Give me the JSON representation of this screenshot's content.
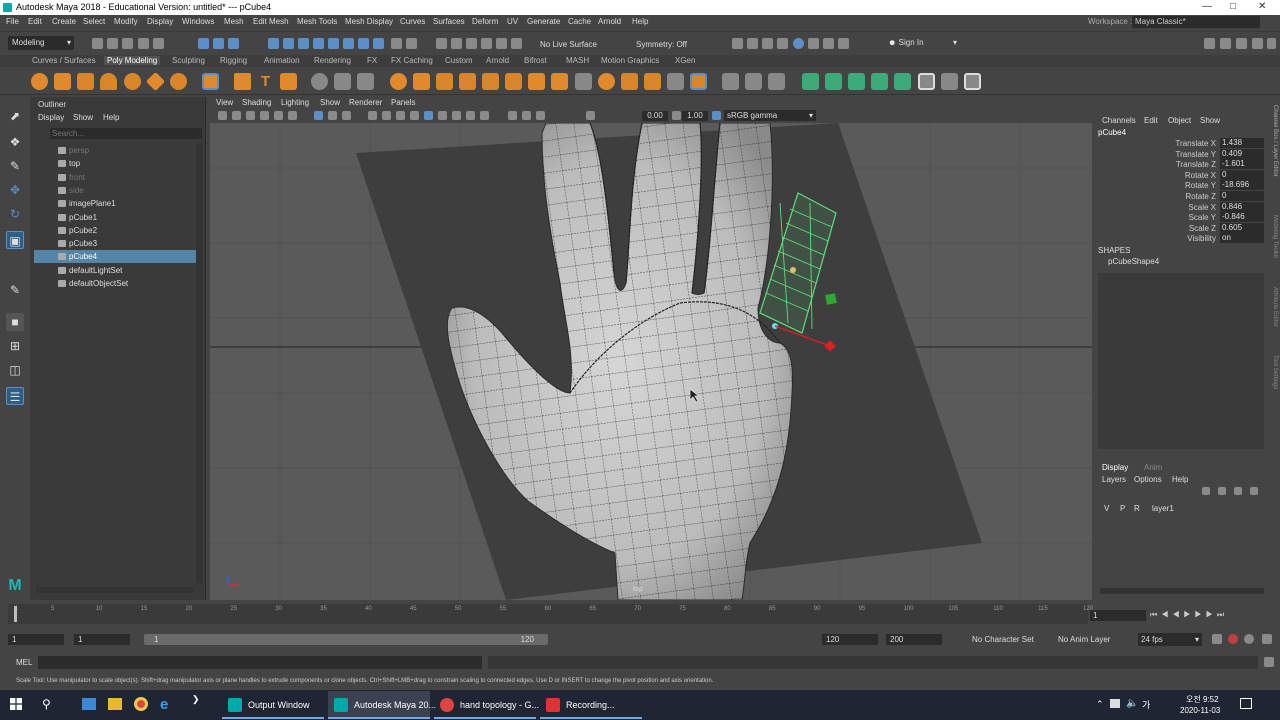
{
  "window": {
    "title": "Autodesk Maya 2018 - Educational Version: untitled*   ---   pCube4"
  },
  "menubar": {
    "items": [
      "File",
      "Edit",
      "Create",
      "Select",
      "Modify",
      "Display",
      "Windows",
      "Mesh",
      "Edit Mesh",
      "Mesh Tools",
      "Mesh Display",
      "Curves",
      "Surfaces",
      "Deform",
      "UV",
      "Generate",
      "Cache",
      "Arnold",
      "Help"
    ],
    "workspace_label": "Workspace :",
    "workspace_value": "Maya Classic*"
  },
  "statusline": {
    "mode": "Modeling",
    "live_surface": "No Live Surface",
    "symmetry": "Symmetry: Off",
    "sign_in": "Sign In"
  },
  "shelf": {
    "tabs": [
      "Curves / Surfaces",
      "Poly Modeling",
      "Sculpting",
      "Rigging",
      "Animation",
      "Rendering",
      "FX",
      "FX Caching",
      "Custom",
      "Arnold",
      "Bifrost",
      "MASH",
      "Motion Graphics",
      "XGen"
    ],
    "active": "Poly Modeling"
  },
  "outliner": {
    "title": "Outliner",
    "menu": [
      "Display",
      "Show",
      "Help"
    ],
    "search_placeholder": "Search...",
    "items": [
      {
        "label": "persp",
        "dim": true
      },
      {
        "label": "top",
        "dim": false
      },
      {
        "label": "front",
        "dim": true
      },
      {
        "label": "side",
        "dim": true
      },
      {
        "label": "imagePlane1",
        "dim": false
      },
      {
        "label": "pCube1",
        "dim": false
      },
      {
        "label": "pCube2",
        "dim": false
      },
      {
        "label": "pCube3",
        "dim": false
      },
      {
        "label": "pCube4",
        "dim": false,
        "selected": true
      },
      {
        "label": "defaultLightSet",
        "dim": false
      },
      {
        "label": "defaultObjectSet",
        "dim": false
      }
    ]
  },
  "viewport": {
    "menu": [
      "View",
      "Shading",
      "Lighting",
      "Show",
      "Renderer",
      "Panels"
    ],
    "field1": "0.00",
    "field2": "1.00",
    "colorspace": "sRGB gamma",
    "camera_label": "top"
  },
  "channelbox": {
    "menu": [
      "Channels",
      "Edit",
      "Object",
      "Show"
    ],
    "object": "pCube4",
    "channels": [
      {
        "label": "Translate X",
        "value": "1.438"
      },
      {
        "label": "Translate Y",
        "value": "0.409"
      },
      {
        "label": "Translate Z",
        "value": "-1.601"
      },
      {
        "label": "Rotate X",
        "value": "0"
      },
      {
        "label": "Rotate Y",
        "value": "-18.696"
      },
      {
        "label": "Rotate Z",
        "value": "0"
      },
      {
        "label": "Scale X",
        "value": "0.846"
      },
      {
        "label": "Scale Y",
        "value": "-0.846"
      },
      {
        "label": "Scale Z",
        "value": "0.605"
      },
      {
        "label": "Visibility",
        "value": "on"
      }
    ],
    "shapes_header": "SHAPES",
    "shape": "pCubeShape4",
    "side_tabs": [
      "Channel Box / Layer Editor",
      "Modeling Toolkit",
      "Attribute Editor",
      "Tool Settings"
    ]
  },
  "layers": {
    "tabs": [
      "Display",
      "Anim"
    ],
    "menu": [
      "Layers",
      "Options",
      "Help"
    ],
    "row": {
      "v": "V",
      "p": "P",
      "r": "R",
      "name": "layer1"
    }
  },
  "timeline": {
    "ticks": [
      "1",
      "5",
      "10",
      "15",
      "20",
      "25",
      "30",
      "35",
      "40",
      "45",
      "50",
      "55",
      "60",
      "65",
      "70",
      "75",
      "80",
      "85",
      "90",
      "95",
      "100",
      "105",
      "110",
      "115",
      "120"
    ],
    "current": "1"
  },
  "range": {
    "start": "1",
    "start2": "1",
    "slider_start": "1",
    "slider_end": "120",
    "end": "120",
    "end2": "200",
    "char_set": "No Character Set",
    "anim_layer": "No Anim Layer",
    "fps": "24 fps"
  },
  "commandline": {
    "label": "MEL"
  },
  "helpline": {
    "text": "Scale Tool: Use manipulator to scale object(s). Shift+drag manipulator axis or plane handles to extrude components or clone objects. Ctrl+Shift+LMB+drag to constrain scaling to connected edges. Use D or INSERT to change the pivot position and axis orientation."
  },
  "taskbar": {
    "items": [
      "Output Window",
      "Autodesk Maya 20...",
      "hand topology - G...",
      "Recording..."
    ],
    "time": "오전 9:52",
    "date": "2020-11-03"
  },
  "colors": {
    "accent": "#5285a6",
    "selection_green": "#5ce07a",
    "mesh": "#c8c8c8"
  }
}
